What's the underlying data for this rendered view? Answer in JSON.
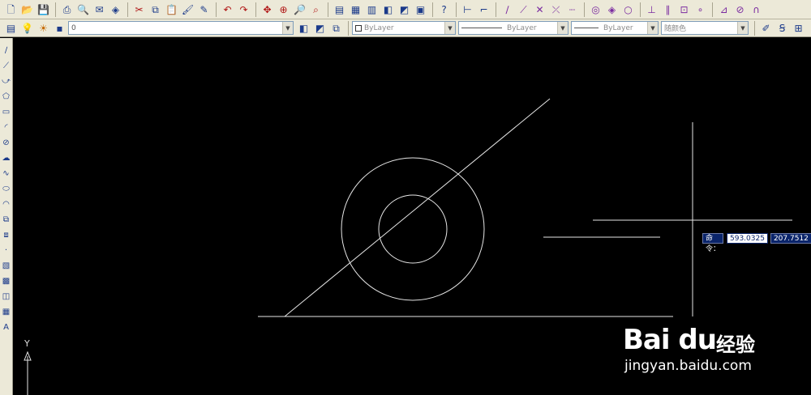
{
  "toolbar_standard": [
    {
      "name": "new-icon",
      "glyph": "🗋"
    },
    {
      "name": "open-icon",
      "glyph": "📂"
    },
    {
      "name": "save-icon",
      "glyph": "💾"
    },
    {
      "sep": true
    },
    {
      "name": "plot-icon",
      "glyph": "⎙"
    },
    {
      "name": "plot-preview-icon",
      "glyph": "🔍"
    },
    {
      "name": "publish-icon",
      "glyph": "✉"
    },
    {
      "name": "3d-dwf-icon",
      "glyph": "◈"
    },
    {
      "sep": true
    },
    {
      "name": "cut-icon",
      "glyph": "✂"
    },
    {
      "name": "copy-icon",
      "glyph": "⧉"
    },
    {
      "name": "paste-icon",
      "glyph": "📋"
    },
    {
      "name": "match-properties-icon",
      "glyph": "🖌"
    },
    {
      "name": "block-editor-icon",
      "glyph": "✎"
    },
    {
      "sep": true
    },
    {
      "name": "undo-icon",
      "glyph": "↶"
    },
    {
      "name": "redo-icon",
      "glyph": "↷"
    },
    {
      "sep": true
    },
    {
      "name": "pan-icon",
      "glyph": "✥"
    },
    {
      "name": "zoom-realtime-icon",
      "glyph": "⊕"
    },
    {
      "name": "zoom-window-icon",
      "glyph": "🔎"
    },
    {
      "name": "zoom-previous-icon",
      "glyph": "⌕"
    },
    {
      "sep": true
    },
    {
      "name": "properties-icon",
      "glyph": "▤"
    },
    {
      "name": "design-center-icon",
      "glyph": "▦"
    },
    {
      "name": "tool-palettes-icon",
      "glyph": "▥"
    },
    {
      "name": "sheet-set-icon",
      "glyph": "◧"
    },
    {
      "name": "markup-icon",
      "glyph": "◩"
    },
    {
      "name": "calculator-icon",
      "glyph": "▣"
    },
    {
      "sep": true
    },
    {
      "name": "help-icon",
      "glyph": "?"
    },
    {
      "sep": true
    },
    {
      "name": "dim-linear-icon",
      "glyph": "⊢"
    },
    {
      "name": "dim-aligned-icon",
      "glyph": "⌐"
    },
    {
      "sep": true
    },
    {
      "name": "snap-endpoint-icon",
      "glyph": "∕"
    },
    {
      "name": "snap-midpoint-icon",
      "glyph": "⟋"
    },
    {
      "name": "snap-intersection-icon",
      "glyph": "✕"
    },
    {
      "name": "snap-apparent-icon",
      "glyph": "⤫"
    },
    {
      "name": "snap-extension-icon",
      "glyph": "┈"
    },
    {
      "sep": true
    },
    {
      "name": "snap-center-icon",
      "glyph": "◎"
    },
    {
      "name": "snap-quadrant-icon",
      "glyph": "◈"
    },
    {
      "name": "snap-tangent-icon",
      "glyph": "○"
    },
    {
      "sep": true
    },
    {
      "name": "snap-perpendicular-icon",
      "glyph": "⊥"
    },
    {
      "name": "snap-parallel-icon",
      "glyph": "∥"
    },
    {
      "name": "snap-insert-icon",
      "glyph": "⊡"
    },
    {
      "name": "snap-node-icon",
      "glyph": "∘"
    },
    {
      "sep": true
    },
    {
      "name": "snap-nearest-icon",
      "glyph": "⊿"
    },
    {
      "name": "snap-none-icon",
      "glyph": "⊘"
    },
    {
      "name": "snap-settings-icon",
      "glyph": "∩"
    }
  ],
  "layer_toolbar": {
    "layer_value": "0"
  },
  "properties_toolbar": {
    "color_value": "ByLayer",
    "linetype_value": "ByLayer",
    "lineweight_value": "ByLayer",
    "plotstyle_value": "随颜色"
  },
  "toolbar_right": [
    {
      "name": "dimension-style-icon",
      "glyph": "✐"
    },
    {
      "name": "text-style-icon",
      "glyph": "Ꞩ"
    },
    {
      "name": "table-style-icon",
      "glyph": "⊞"
    },
    {
      "name": "multileader-icon",
      "glyph": "⊕"
    },
    {
      "name": "grid-icon",
      "glyph": "▦"
    },
    {
      "name": "array-icon",
      "glyph": "⊞"
    },
    {
      "name": "view-icon",
      "glyph": "◰"
    }
  ],
  "draw_toolbar": [
    {
      "name": "line-icon",
      "glyph": "∕"
    },
    {
      "name": "construction-line-icon",
      "glyph": "⟋"
    },
    {
      "name": "polyline-icon",
      "glyph": "⤻"
    },
    {
      "name": "polygon-icon",
      "glyph": "⬠"
    },
    {
      "name": "rectangle-icon",
      "glyph": "▭"
    },
    {
      "name": "arc-icon",
      "glyph": "◜"
    },
    {
      "name": "circle-icon",
      "glyph": "⊘"
    },
    {
      "name": "revision-cloud-icon",
      "glyph": "☁"
    },
    {
      "name": "spline-icon",
      "glyph": "∿"
    },
    {
      "name": "ellipse-icon",
      "glyph": "⬭"
    },
    {
      "name": "ellipse-arc-icon",
      "glyph": "◠"
    },
    {
      "name": "insert-block-icon",
      "glyph": "⧉"
    },
    {
      "name": "make-block-icon",
      "glyph": "⧈"
    },
    {
      "name": "point-icon",
      "glyph": "·"
    },
    {
      "name": "hatch-icon",
      "glyph": "▧"
    },
    {
      "name": "gradient-icon",
      "glyph": "▩"
    },
    {
      "name": "region-icon",
      "glyph": "◫"
    },
    {
      "name": "table-icon",
      "glyph": "▦"
    },
    {
      "name": "multiline-text-icon",
      "glyph": "A"
    }
  ],
  "command_tooltip": {
    "label": "命令：",
    "x_value": "593.0325",
    "y_value": "207.7512"
  },
  "ucs": {
    "axis_label": "Y"
  },
  "watermark": {
    "brand": "Bai du",
    "cn": "经验",
    "url": "jingyan.baidu.com"
  },
  "colors": {
    "background": "#000000",
    "geometry": "#e6e6e6",
    "toolbar": "#ece9d8",
    "highlight": "#0a246a"
  }
}
